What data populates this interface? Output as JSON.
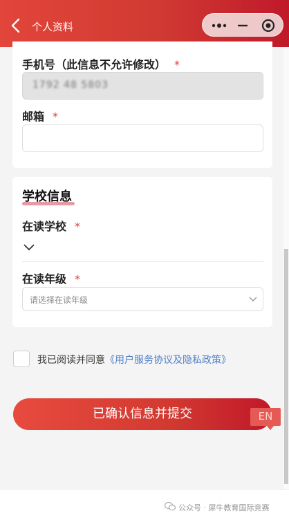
{
  "header": {
    "title": "个人资料",
    "back_icon": "chevron-left-icon",
    "capsule_icons": [
      "more-dots-icon",
      "minus-icon",
      "target-icon"
    ]
  },
  "form": {
    "phone": {
      "label": "手机号（此信息不允许修改）",
      "required": "*",
      "value": "1792 48 5803"
    },
    "email": {
      "label": "邮箱",
      "required": "*",
      "value": ""
    },
    "school_section": {
      "title": "学校信息",
      "school": {
        "label": "在读学校",
        "required": "*"
      },
      "grade": {
        "label": "在读年级",
        "required": "*",
        "placeholder": "请选择在读年级"
      }
    },
    "agreement": {
      "text": "我已阅读并同意",
      "link": "《用户服务协议及隐私政策》",
      "checked": false
    },
    "submit_label": "已确认信息并提交"
  },
  "en_badge": "EN",
  "footer": {
    "text": "公众号 · 犀牛教育国际竞赛"
  },
  "colors": {
    "brand_red": "#d23a31",
    "link_blue": "#4f7fc7",
    "required_red": "#e23b3b"
  }
}
